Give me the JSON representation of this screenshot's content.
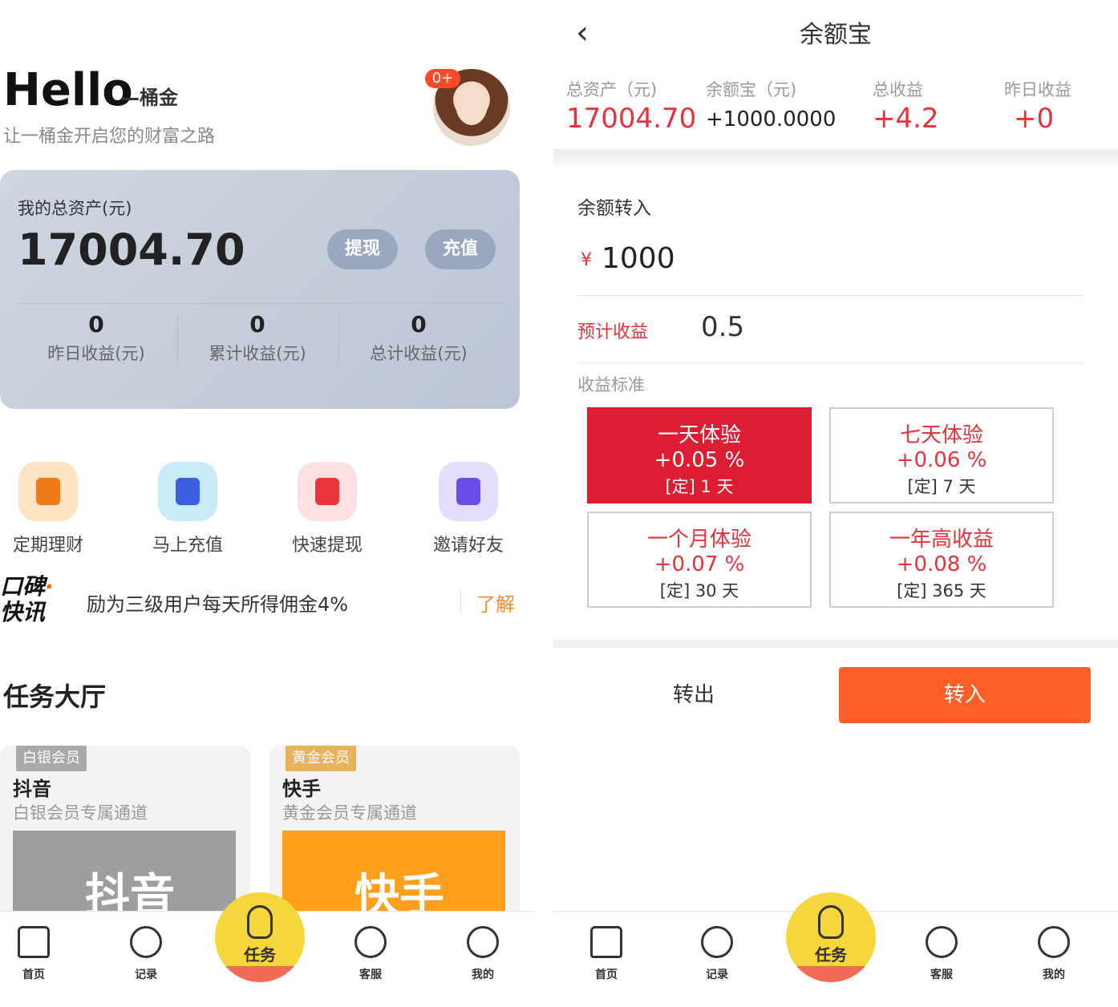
{
  "left": {
    "hello": "Hello",
    "hello_suffix": "—桶金",
    "tagline": "让一桶金开启您的财富之路",
    "badge": "0+",
    "asset_label": "我的总资产(元)",
    "asset_value": "17004.70",
    "withdraw_label": "提现",
    "recharge_label": "充值",
    "stats": [
      {
        "value": "0",
        "label": "昨日收益(元)"
      },
      {
        "value": "0",
        "label": "累计收益(元)"
      },
      {
        "value": "0",
        "label": "总计收益(元)"
      }
    ],
    "quick_actions": [
      {
        "label": "定期理财",
        "icon": "briefcase-icon",
        "bg": "#fde3c2",
        "fg": "#f07a18"
      },
      {
        "label": "马上充值",
        "icon": "user-icon",
        "bg": "#c8ebf7",
        "fg": "#3a5fe0"
      },
      {
        "label": "快速提现",
        "icon": "bookmark-icon",
        "bg": "#fde0e2",
        "fg": "#e8363b"
      },
      {
        "label": "邀请好友",
        "icon": "wallet-icon",
        "bg": "#e3ddfb",
        "fg": "#6a4de8"
      }
    ],
    "news_logo_line1": "口碑",
    "news_logo_dot": "·",
    "news_logo_line2": "快讯",
    "news_text": "励为三级用户每天所得佣金4%",
    "news_link": "了解",
    "section_title": "任务大厅",
    "tasks": [
      {
        "tag": "白银会员",
        "tag_color": "#a9a9a9",
        "name": "抖音",
        "desc": "白银会员专属通道",
        "brand": "抖音",
        "img_bg": "#9e9e9e"
      },
      {
        "tag": "黄金会员",
        "tag_color": "#e9b25c",
        "name": "快手",
        "desc": "黄金会员专属通道",
        "brand": "快手",
        "img_bg": "#ff9f1c"
      }
    ]
  },
  "nav": {
    "home": "首页",
    "records": "记录",
    "task": "任务",
    "service": "客服",
    "mine": "我的"
  },
  "right": {
    "title": "余额宝",
    "summary": [
      {
        "label": "总资产（元)",
        "value": "17004.70"
      },
      {
        "label": "余额宝（元)",
        "value": "+1000.0000"
      },
      {
        "label": "总收益",
        "value": "+4.2"
      },
      {
        "label": "昨日收益",
        "value": "+0"
      }
    ],
    "transfer_in_label": "余额转入",
    "currency": "¥",
    "amount": "1000",
    "estimate_label": "预计收益",
    "estimate_value": "0.5",
    "standard_label": "收益标准",
    "plans": [
      {
        "title": "一天体验",
        "rate": "+0.05 %",
        "duration": "[定] 1 天",
        "active": true
      },
      {
        "title": "七天体验",
        "rate": "+0.06 %",
        "duration": "[定] 7 天",
        "active": false
      },
      {
        "title": "一个月体验",
        "rate": "+0.07 %",
        "duration": "[定] 30 天",
        "active": false
      },
      {
        "title": "一年高收益",
        "rate": "+0.08 %",
        "duration": "[定] 365 天",
        "active": false
      }
    ],
    "out_button": "转出",
    "in_button": "转入"
  },
  "colors": {
    "accent_red": "#e5323b",
    "orange": "#ff5e28",
    "nav_center": "#f5d63c"
  }
}
